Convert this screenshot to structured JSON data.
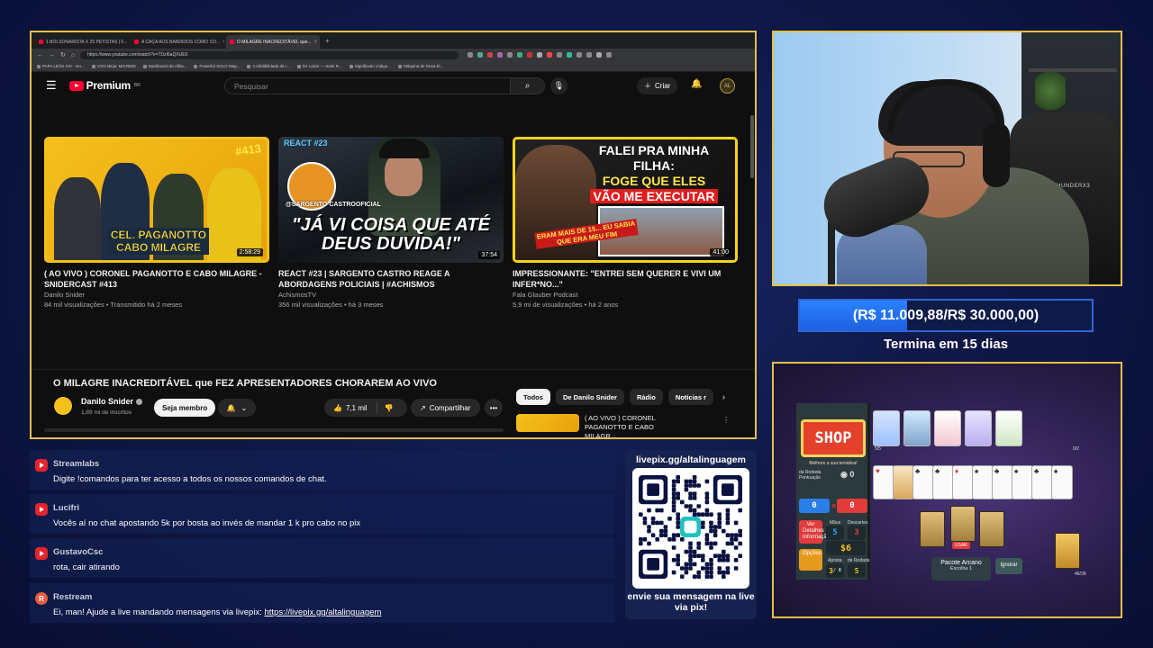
{
  "browser": {
    "tabs": [
      {
        "label": "1 BOLSONARISTA X 25 PETISTAS | F...",
        "active": false
      },
      {
        "label": "A CAÇA AOS BANDIDOS COMO CO...",
        "active": false
      },
      {
        "label": "O MILAGRE INACREDITÁVEL que...",
        "active": true
      }
    ],
    "url": "https://www.youtube.com/watch?v=TDzI6aQXUE0",
    "bookmarks": [
      "PAPA LEÃO XIV - Go...",
      "VOO.Ninja: MICRIM3",
      "Dashboard de Afilia...",
      "Powerful SOLO Mag...",
      "A infalibilidade da I...",
      "De Laicis — Saint R...",
      "Significado código...",
      "Máquina de Rosa El..."
    ]
  },
  "youtube": {
    "brand": "Premium",
    "brand_suffix": "BR",
    "search_placeholder": "Pesquisar",
    "create_label": "Criar",
    "avatar_text": "AL",
    "videos": [
      {
        "title": "( AO VIVO ) CORONEL PAGANOTTO E CABO MILAGRE - SNIDERCAST #413",
        "channel": "Danilo Snider",
        "meta": "84 mil visualizações • Transmitido há 2 meses",
        "duration": "2:58:29",
        "thumb_caption": "CEL. PAGANOTTO CABO MILAGRE",
        "thumb_badge": "#413"
      },
      {
        "title": "REACT #23 | SARGENTO CASTRO REAGE A ABORDAGENS POLICIAIS | #ACHISMOS",
        "channel": "AchismosTV",
        "meta": "356 mil visualizações • há 3 meses",
        "duration": "37:54",
        "thumb_react": "REACT #23",
        "thumb_tag": "@SARGENTO CASTROOFICIAL",
        "thumb_quote": "\"JÁ VI COISA QUE ATÉ DEUS DUVIDA!\""
      },
      {
        "title": "IMPRESSIONANTE: \"ENTREI SEM QUERER E VIVI UM INFER*NO...\"",
        "channel": "Fala Glauber Podcast",
        "meta": "5,9 mi de visualizações • há 2 anos",
        "duration": "41:00",
        "thumb_line1": "FALEI PRA MINHA FILHA:",
        "thumb_line2": "FOGE QUE ELES",
        "thumb_line3": "VÃO ME EXECUTAR",
        "thumb_red": "ERAM MAIS DE 15... EU SABIA QUE ERA MEU FIM"
      }
    ],
    "current": {
      "title": "O MILAGRE INACREDITÁVEL que FEZ APRESENTADORES CHORAREM AO VIVO",
      "channel": "Danilo Snider",
      "subs": "1,89 mi de inscritos",
      "member_label": "Seja membro",
      "likes": "7,1 mil",
      "share_label": "Compartilhar"
    },
    "chips": [
      "Todos",
      "De Danilo Snider",
      "Rádio",
      "Notícias r"
    ],
    "next_title": "( AO VIVO ) CORONEL PAGANOTTO E CABO MILAGR..."
  },
  "webcam": {
    "chair_brand": "THUNDERX3"
  },
  "goal": {
    "text": "(R$ 11.009,88/R$ 30.000,00)",
    "progress": 0.367,
    "ends": "Termina em 15 dias"
  },
  "game": {
    "shop_label": "SHOP",
    "shop_sub": "Melhore a sua tentativa!",
    "round_label": "da Rodada Pontuação",
    "round_score": "0",
    "chips": "0",
    "mult": "0",
    "hands_label": "Mãos",
    "hands": "5",
    "discards_label": "Descartes",
    "discards": "3",
    "money": "$6",
    "ante_label": "Aposta",
    "ante": "3",
    "ante_of": "/ 8",
    "round_label2": "de Rodada",
    "round": "5",
    "info_label": "Ver Detalhes Informação",
    "options_label": "Opções",
    "pack_title": "Pacote Arcano",
    "pack_sub": "Escolha 1",
    "skip_label": "Ignorar",
    "buy_label": "USAR",
    "jokers_count": "5/5",
    "consumables_count": "0/2",
    "deck_count": "46/39"
  },
  "chat": [
    {
      "user": "Streamlabs",
      "text": "Digite !comandos para ter acesso a todos os nossos comandos de chat.",
      "source": "youtube"
    },
    {
      "user": "Lucifri",
      "text": "Vocês aí no chat apostando 5k por bosta ao invés de mandar 1 k pro cabo no pix",
      "source": "youtube"
    },
    {
      "user": "GustavoCsc",
      "text": "rota, cair atirando",
      "source": "youtube"
    },
    {
      "user": "Restream",
      "text": "Ei, man! Ajude a live mandando mensagens via livepix: ",
      "link": "https://livepix.gg/altalinguagem",
      "source": "restream"
    }
  ],
  "qr": {
    "url_label": "livepix.gg/altalinguagem",
    "caption": "envie sua mensagem na live via pix!"
  },
  "colors": {
    "frame_gold": "#e3bf48",
    "yt_red": "#ff0033",
    "goal_blue": "#2a82ff",
    "background": "#0f1848"
  }
}
